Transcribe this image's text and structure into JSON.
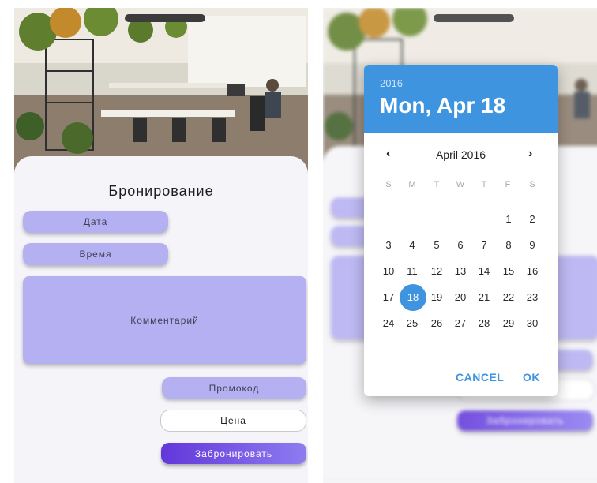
{
  "booking": {
    "title": "Бронирование",
    "date_button": "Дата",
    "time_button": "Время",
    "comment_field": "Комментарий",
    "promo_button": "Промокод",
    "price_field": "Цена",
    "book_button": "Забронировать"
  },
  "date_picker": {
    "year": "2016",
    "selected_date": "Mon, Apr 18",
    "month_label": "April 2016",
    "prev_icon": "‹",
    "next_icon": "›",
    "weekdays": [
      "S",
      "M",
      "T",
      "W",
      "T",
      "F",
      "S"
    ],
    "days": [
      "1",
      "2",
      "3",
      "4",
      "5",
      "6",
      "7",
      "8",
      "9",
      "10",
      "11",
      "12",
      "13",
      "14",
      "15",
      "16",
      "17",
      "18",
      "19",
      "20",
      "21",
      "22",
      "23",
      "24",
      "25",
      "26",
      "27",
      "28",
      "29",
      "30"
    ],
    "selected_day": "18",
    "cancel_button": "CANCEL",
    "ok_button": "OK"
  },
  "colors": {
    "accent": "#3f94df",
    "lavender": "#b5b0f2",
    "button_gradient_start": "#6237da",
    "button_gradient_end": "#8e7cf0"
  }
}
